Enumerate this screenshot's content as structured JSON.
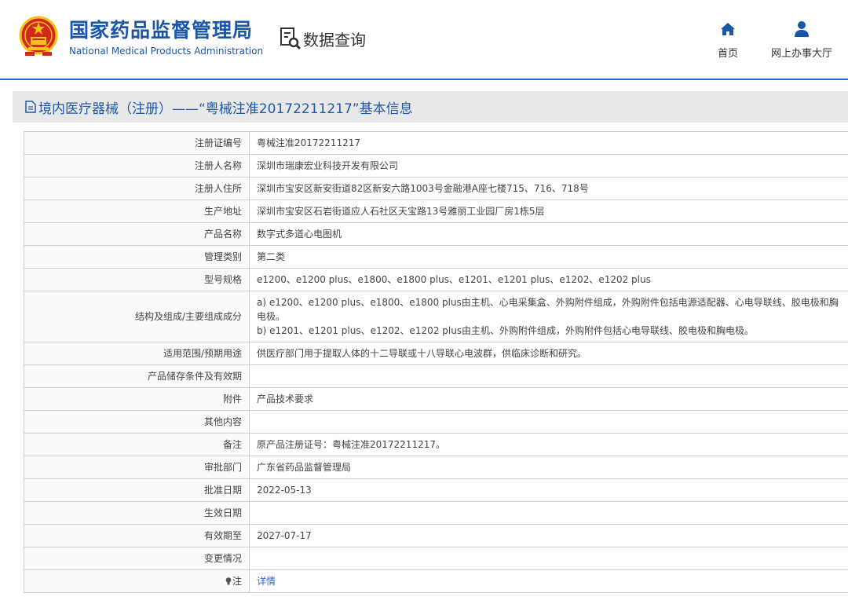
{
  "header": {
    "agency_name_cn": "国家药品监督管理局",
    "agency_name_en": "National Medical Products Administration",
    "query_label": "数据查询",
    "nav": [
      {
        "label": "首页",
        "icon": "home-icon"
      },
      {
        "label": "网上办事大厅",
        "icon": "user-icon"
      }
    ]
  },
  "page": {
    "title": "境内医疗器械（注册）——“粤械注准20172211217”基本信息"
  },
  "rows": [
    {
      "label": "注册证编号",
      "value": "粤械注准20172211217"
    },
    {
      "label": "注册人名称",
      "value": "深圳市瑞康宏业科技开发有限公司"
    },
    {
      "label": "注册人住所",
      "value": "深圳市宝安区新安街道82区新安六路1003号金融港A座七楼715、716、718号"
    },
    {
      "label": "生产地址",
      "value": "深圳市宝安区石岩街道应人石社区天宝路13号雅丽工业园厂房1栋5层"
    },
    {
      "label": "产品名称",
      "value": "数字式多道心电图机"
    },
    {
      "label": "管理类别",
      "value": "第二类"
    },
    {
      "label": "型号规格",
      "value": "e1200、e1200 plus、e1800、e1800 plus、e1201、e1201 plus、e1202、e1202 plus"
    },
    {
      "label": "结构及组成/主要组成成分",
      "value_lines": [
        "a) e1200、e1200 plus、e1800、e1800 plus由主机、心电采集盒、外购附件组成，外购附件包括电源适配器、心电导联线、胶电极和胸电极。",
        "b) e1201、e1201 plus、e1202、e1202 plus由主机、外购附件组成，外购附件包括心电导联线、胶电极和胸电极。"
      ]
    },
    {
      "label": "适用范围/预期用途",
      "value": "供医疗部门用于提取人体的十二导联或十八导联心电波群，供临床诊断和研究。"
    },
    {
      "label": "产品储存条件及有效期",
      "value": ""
    },
    {
      "label": "附件",
      "value": "产品技术要求"
    },
    {
      "label": "其他内容",
      "value": ""
    },
    {
      "label": "备注",
      "value": "原产品注册证号：粤械注准20172211217。"
    },
    {
      "label": "审批部门",
      "value": "广东省药品监督管理局"
    },
    {
      "label": "批准日期",
      "value": "2022-05-13"
    },
    {
      "label": "生效日期",
      "value": ""
    },
    {
      "label": "有效期至",
      "value": "2027-07-17"
    },
    {
      "label": "变更情况",
      "value": ""
    },
    {
      "label": "注",
      "value": "详情",
      "icon": "lightbulb-icon",
      "link": true
    }
  ],
  "colors": {
    "brand_blue": "#1a56a8",
    "link_blue": "#2a66c4",
    "emblem_red": "#d5281d",
    "emblem_gold": "#f3c316"
  }
}
